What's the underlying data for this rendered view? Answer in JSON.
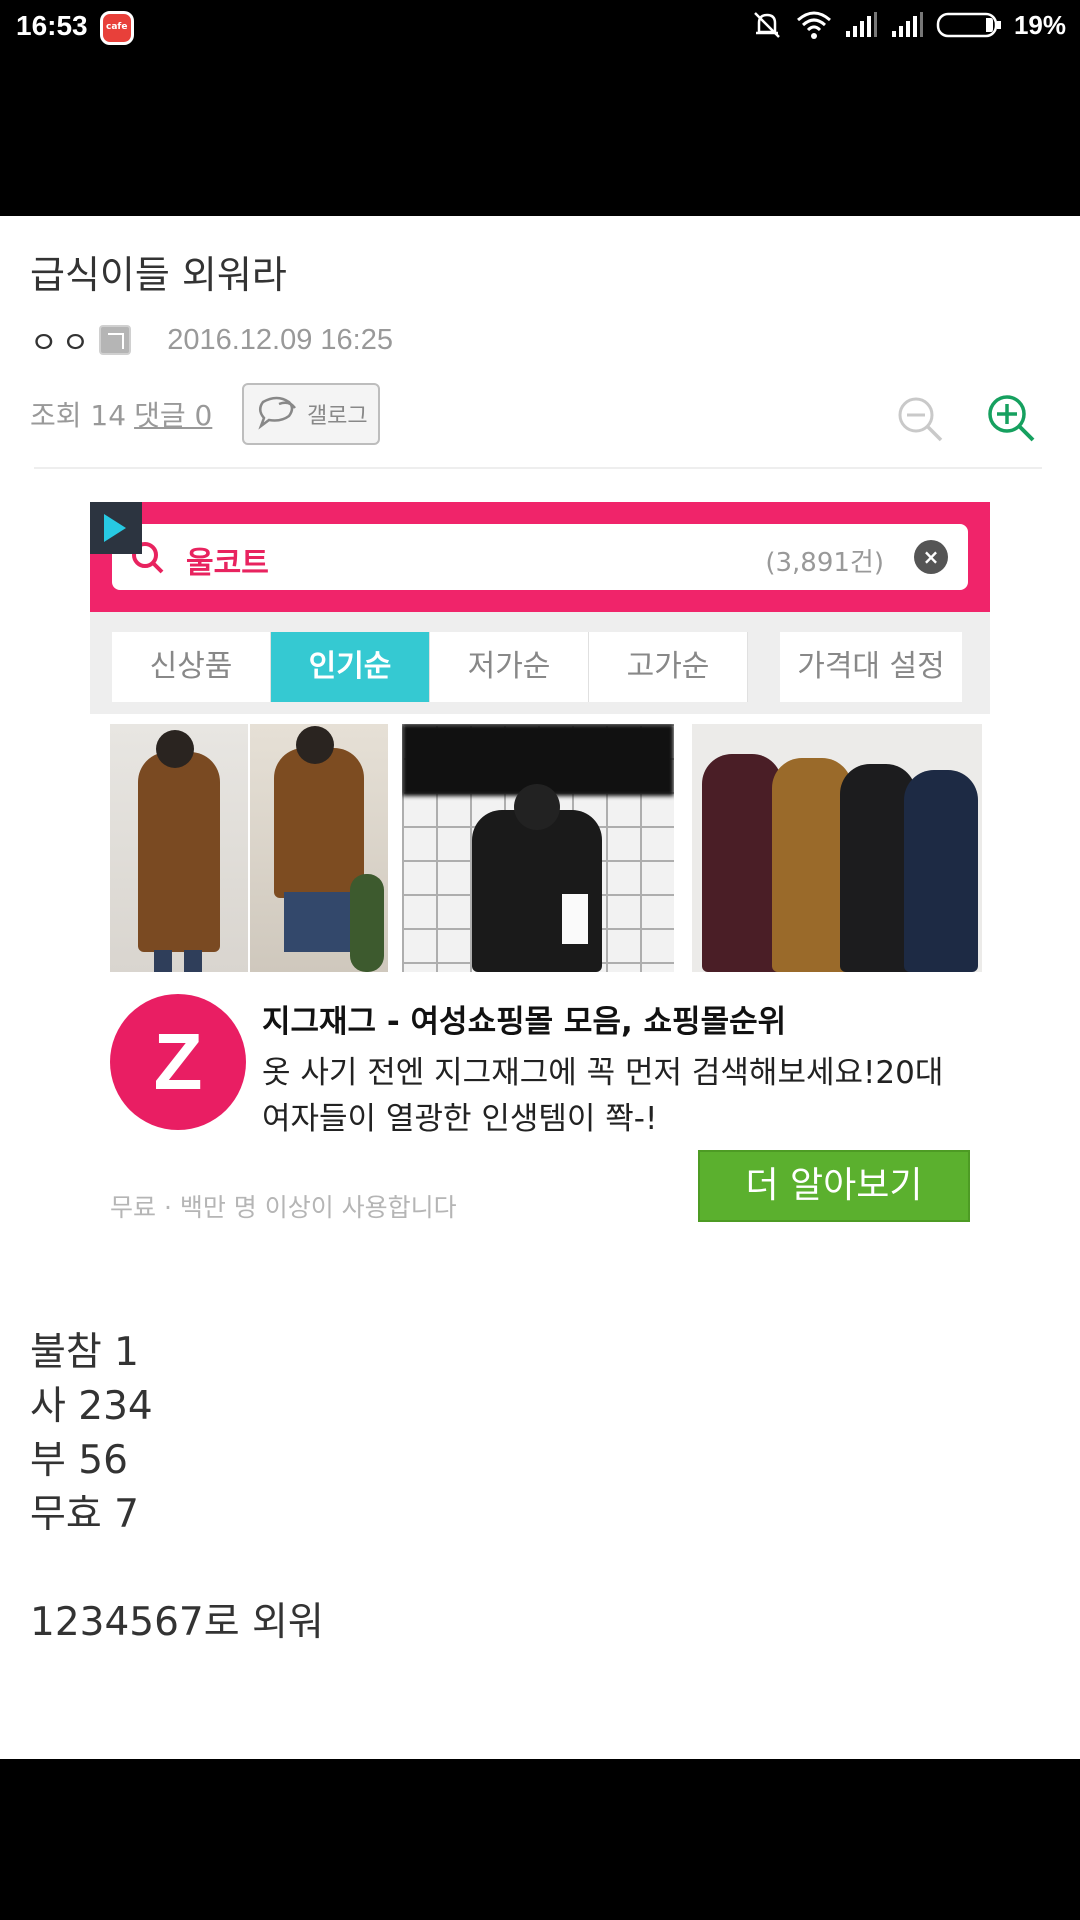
{
  "status_bar": {
    "time": "16:53",
    "app_icon_label": "cafe",
    "battery_percent": "19%",
    "icons": [
      "mute-icon",
      "wifi-icon",
      "signal-icon",
      "signal-icon",
      "battery-icon"
    ]
  },
  "article": {
    "title": "급식이들 외워라",
    "author": "ㅇㅇ",
    "date": "2016.12.09 16:25",
    "views": "조회 14",
    "comments": "댓글 0",
    "gallog_label": "갤로그"
  },
  "ad": {
    "search_query": "울코트",
    "result_count": "(3,891건)",
    "tabs": [
      "신상품",
      "인기순",
      "저가순",
      "고가순"
    ],
    "active_tab": "인기순",
    "price_tab": "가격대 설정",
    "logo_letter": "Z",
    "title": "지그재그 - 여성쇼핑몰 모음, 쇼핑몰순위",
    "description": "옷 사기 전엔 지그재그에 꼭 먼저 검색해보세요!20대 여자들이 열광한 인생템이 쫙-!",
    "subtitle": "무료 · 백만 명 이상이 사용합니다",
    "cta": "더 알아보기",
    "colors": {
      "band": "#f0246a",
      "active_tab": "#35c9d2",
      "logo": "#e91e63",
      "cta": "#5bb02e"
    }
  },
  "body": {
    "lines": [
      "불참 1",
      "사 234",
      "부 56",
      "무효 7",
      "",
      "1234567로 외워"
    ]
  }
}
